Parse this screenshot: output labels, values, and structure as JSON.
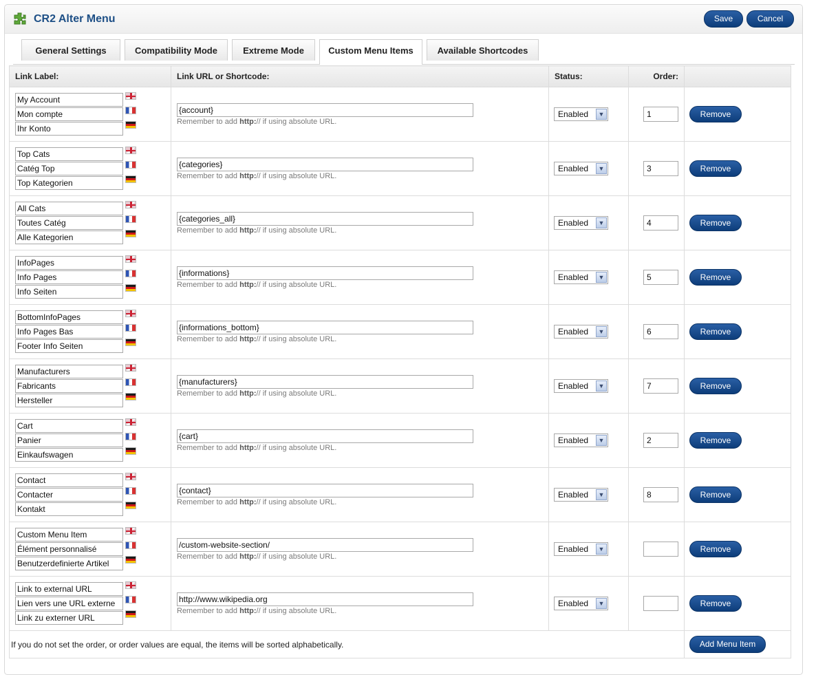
{
  "header": {
    "title": "CR2 Alter Menu",
    "icon": "puzzle-icon",
    "save_label": "Save",
    "cancel_label": "Cancel"
  },
  "tabs": [
    {
      "label": "General Settings",
      "active": false
    },
    {
      "label": "Compatibility Mode",
      "active": false
    },
    {
      "label": "Extreme Mode",
      "active": false
    },
    {
      "label": "Custom Menu Items",
      "active": true
    },
    {
      "label": "Available Shortcodes",
      "active": false
    }
  ],
  "table": {
    "headers": {
      "label": "Link Label:",
      "url": "Link URL or Shortcode:",
      "status": "Status:",
      "order": "Order:"
    },
    "hint": {
      "prefix": "Remember to add ",
      "bold": "http:",
      "suffix": "// if using absolute URL."
    },
    "remove_label": "Remove",
    "flags": [
      "flag-en-icon",
      "flag-fr-icon",
      "flag-de-icon"
    ],
    "rows": [
      {
        "labels": [
          "My Account",
          "Mon compte",
          "Ihr Konto"
        ],
        "url": "{account}",
        "status": "Enabled",
        "order": "1"
      },
      {
        "labels": [
          "Top Cats",
          "Catég Top",
          "Top Kategorien"
        ],
        "url": "{categories}",
        "status": "Enabled",
        "order": "3"
      },
      {
        "labels": [
          "All Cats",
          "Toutes Catég",
          "Alle Kategorien"
        ],
        "url": "{categories_all}",
        "status": "Enabled",
        "order": "4"
      },
      {
        "labels": [
          "InfoPages",
          "Info Pages",
          "Info Seiten"
        ],
        "url": "{informations}",
        "status": "Enabled",
        "order": "5"
      },
      {
        "labels": [
          "BottomInfoPages",
          "Info Pages Bas",
          "Footer Info Seiten"
        ],
        "url": "{informations_bottom}",
        "status": "Enabled",
        "order": "6"
      },
      {
        "labels": [
          "Manufacturers",
          "Fabricants",
          "Hersteller"
        ],
        "url": "{manufacturers}",
        "status": "Enabled",
        "order": "7"
      },
      {
        "labels": [
          "Cart",
          "Panier",
          "Einkaufswagen"
        ],
        "url": "{cart}",
        "status": "Enabled",
        "order": "2"
      },
      {
        "labels": [
          "Contact",
          "Contacter",
          "Kontakt"
        ],
        "url": "{contact}",
        "status": "Enabled",
        "order": "8"
      },
      {
        "labels": [
          "Custom Menu Item",
          "Élément personnalisé",
          "Benutzerdefinierte Artikel"
        ],
        "url": "/custom-website-section/",
        "status": "Enabled",
        "order": ""
      },
      {
        "labels": [
          "Link to external URL",
          "Lien vers une URL externe",
          "Link zu externer URL"
        ],
        "url": "http://www.wikipedia.org",
        "status": "Enabled",
        "order": ""
      }
    ]
  },
  "footer": {
    "note": "If you do not set the order, or order values are equal, the items will be sorted alphabetically.",
    "add_label": "Add Menu Item"
  },
  "colors": {
    "accent": "#0d3d7a",
    "title": "#1d4f86"
  }
}
